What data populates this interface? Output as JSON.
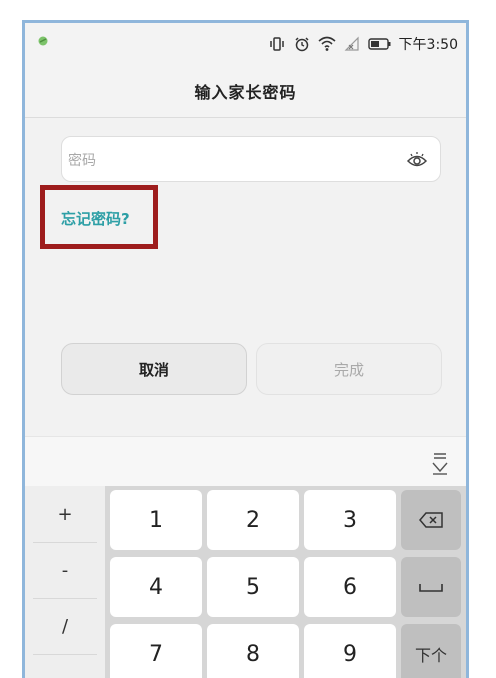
{
  "status_bar": {
    "time": "下午3:50",
    "icons": [
      "vibrate-icon",
      "alarm-icon",
      "wifi-icon",
      "no-signal-icon",
      "battery-icon"
    ]
  },
  "header": {
    "title": "输入家长密码"
  },
  "password": {
    "placeholder": "密码",
    "visibility_icon": "eye-icon"
  },
  "forgot_password_label": "忘记密码?",
  "buttons": {
    "cancel": "取消",
    "done": "完成"
  },
  "keyboard": {
    "hide_icon": "keyboard-hide-icon",
    "side_keys": [
      "+",
      "-",
      "/",
      "."
    ],
    "digits": [
      "1",
      "2",
      "3",
      "4",
      "5",
      "6",
      "7",
      "8",
      "9"
    ],
    "backspace_icon": "backspace-icon",
    "space_icon": "space-icon",
    "next_label": "下个"
  },
  "colors": {
    "link": "#2d9fa6",
    "highlight_box": "#9e1d1d",
    "frame_border": "#8fb6db"
  }
}
